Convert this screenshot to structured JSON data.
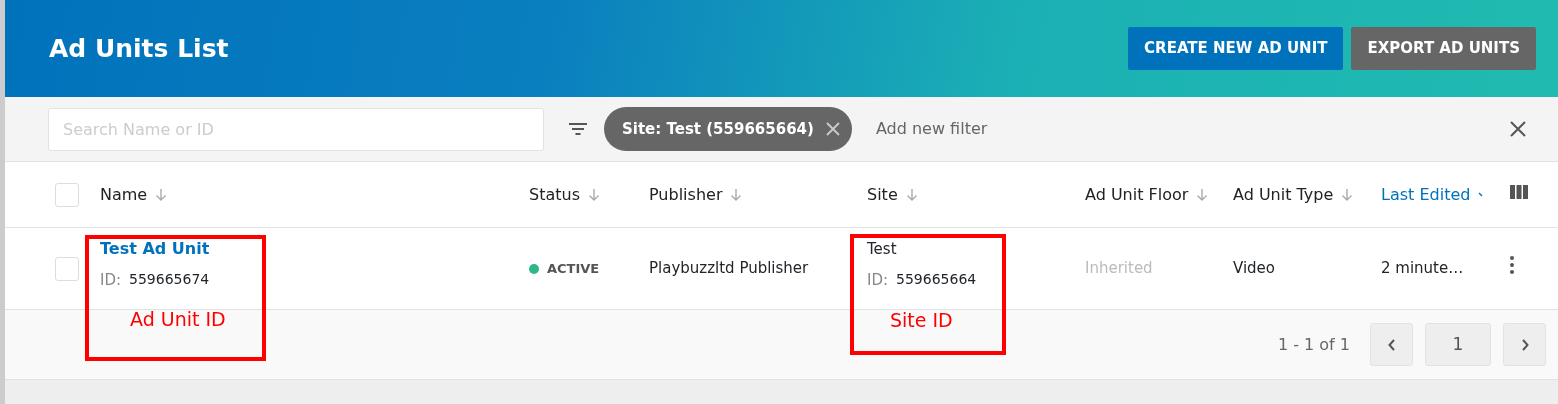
{
  "header": {
    "title": "Ad Units List",
    "buttons": [
      {
        "label": "CREATE NEW AD UNIT",
        "kind": "primary"
      },
      {
        "label": "EXPORT AD UNITS",
        "kind": "secondary"
      }
    ]
  },
  "filter_bar": {
    "search": {
      "placeholder": "Search Name or ID"
    },
    "chips": [
      {
        "label": "Site: Test (559665664)"
      }
    ],
    "add_filter": "Add new filter"
  },
  "table": {
    "select_all": {
      "checked": false
    },
    "columns": [
      {
        "label": "Name",
        "sorted": false
      },
      {
        "label": "Status",
        "sorted": false
      },
      {
        "label": "Publisher",
        "sorted": false
      },
      {
        "label": "Site",
        "sorted": false
      },
      {
        "label": "Ad Unit Floor",
        "sorted": false
      },
      {
        "label": "Ad Unit Type",
        "sorted": false
      },
      {
        "label": "Last Edited",
        "sorted": true
      }
    ],
    "rows": [
      {
        "checked": false,
        "name": "Test Ad Unit",
        "id_label": "ID:",
        "id": "559665674",
        "status": "ACTIVE",
        "color": "#2eb887",
        "publisher": "Playbuzzltd Publisher",
        "site": "Test",
        "site_id_label": "ID:",
        "site_id": "559665664",
        "floor": "Inherited",
        "type": "Video",
        "last_edited": "2 minute…"
      }
    ]
  },
  "pagination": {
    "range": "1 - 1 of 1",
    "page": "1"
  },
  "annotations": [
    {
      "label": "Ad Unit ID"
    },
    {
      "label": "Site ID"
    }
  ]
}
